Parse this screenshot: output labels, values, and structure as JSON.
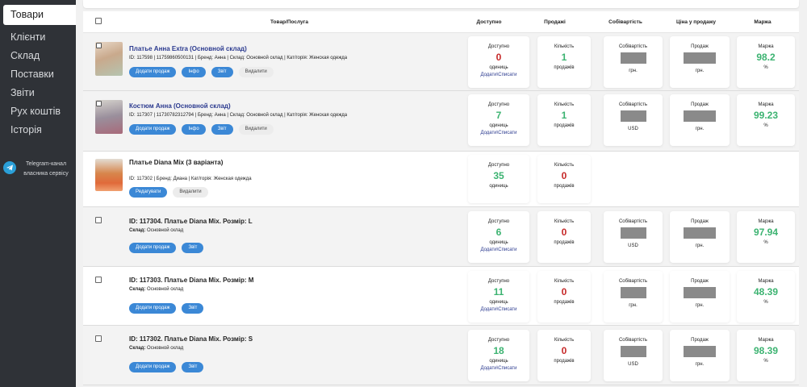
{
  "sidebar": {
    "items": [
      {
        "label": "Товари",
        "active": true
      },
      {
        "label": "Клієнти"
      },
      {
        "label": "Склад"
      },
      {
        "label": "Поставки"
      },
      {
        "label": "Звіти"
      },
      {
        "label": "Рух коштів"
      },
      {
        "label": "Історія"
      }
    ],
    "telegram": "Telegram-канал власника сервісу"
  },
  "table": {
    "headers": {
      "product": "Товар/Послуга",
      "available": "Доступно",
      "sales": "Продажі",
      "cost": "Собівартість",
      "price": "Ціна у продажу",
      "margin": "Маржа"
    }
  },
  "rows": [
    {
      "title": "Платье Анна Extra (Основной склад)",
      "meta": "ID: 117598 | 11759860500131 | Бренд: Анна | Склад: Основной склад | Кат/горія: Женская одежда",
      "buttons": [
        "Додати продаж",
        "Інфо",
        "Звіт",
        "Видалити"
      ],
      "available": {
        "label": "Доступно",
        "value": "0",
        "unit": "одиниць",
        "link": "Додати\\Списати"
      },
      "sales": {
        "label": "Кількість",
        "value": "1",
        "unit": "продажів"
      },
      "cost": {
        "label": "Собівартість",
        "unit": "грн."
      },
      "price": {
        "label": "Продаж",
        "unit": "грн."
      },
      "margin": {
        "label": "Маржа",
        "value": "98.2",
        "unit": "%"
      }
    },
    {
      "title": "Костюм Анна (Основной склад)",
      "meta": "ID: 117307 | 11730782312794 | Бренд: Анна | Склад: Основной склад | Кат/горія: Женская одежда",
      "buttons": [
        "Додати продаж",
        "Інфо",
        "Звіт",
        "Видалити"
      ],
      "available": {
        "label": "Доступно",
        "value": "7",
        "unit": "одиниць",
        "link": "Додати\\Списати"
      },
      "sales": {
        "label": "Кількість",
        "value": "1",
        "unit": "продажів"
      },
      "cost": {
        "label": "Собівартість",
        "unit": "USD"
      },
      "price": {
        "label": "Продаж",
        "unit": "грн."
      },
      "margin": {
        "label": "Маржа",
        "value": "99.23",
        "unit": "%"
      }
    },
    {
      "title": "Платье Diana Mix (3 варіанта)",
      "meta": "ID: 117302 | Бренд: Диана | Кат/горія: Женская одежда",
      "buttons": [
        "Редагувати",
        "Видалити"
      ],
      "available": {
        "label": "Доступно",
        "value": "35",
        "unit": "одиниць"
      },
      "sales": {
        "label": "Кількість",
        "value": "0",
        "unit": "продажів"
      }
    },
    {
      "title": "ID: 117304. Платье Diana Mix. Розмір: L",
      "meta_label": "Склад:",
      "meta_value": "Основной склад",
      "buttons": [
        "Додати продаж",
        "Звіт"
      ],
      "available": {
        "label": "Доступно",
        "value": "6",
        "unit": "одиниць",
        "link": "Додати\\Списати"
      },
      "sales": {
        "label": "Кількість",
        "value": "0",
        "unit": "продажів"
      },
      "cost": {
        "label": "Собівартість",
        "unit": "USD"
      },
      "price": {
        "label": "Продаж",
        "unit": "грн."
      },
      "margin": {
        "label": "Маржа",
        "value": "97.94",
        "unit": "%"
      }
    },
    {
      "title": "ID: 117303. Платье Diana Mix. Розмір: M",
      "meta_label": "Склад:",
      "meta_value": "Основной склад",
      "buttons": [
        "Додати продаж",
        "Звіт"
      ],
      "available": {
        "label": "Доступно",
        "value": "11",
        "unit": "одиниць",
        "link": "Додати\\Списати"
      },
      "sales": {
        "label": "Кількість",
        "value": "0",
        "unit": "продажів"
      },
      "cost": {
        "label": "Собівартість",
        "unit": "грн."
      },
      "price": {
        "label": "Продаж",
        "unit": "грн."
      },
      "margin": {
        "label": "Маржа",
        "value": "48.39",
        "unit": "%"
      }
    },
    {
      "title": "ID: 117302. Платье Diana Mix. Розмір: S",
      "meta_label": "Склад:",
      "meta_value": "Основной склад",
      "buttons": [
        "Додати продаж",
        "Звіт"
      ],
      "available": {
        "label": "Доступно",
        "value": "18",
        "unit": "одиниць",
        "link": "Додати\\Списати"
      },
      "sales": {
        "label": "Кількість",
        "value": "0",
        "unit": "продажів"
      },
      "cost": {
        "label": "Собівартість",
        "unit": "USD"
      },
      "price": {
        "label": "Продаж",
        "unit": "грн."
      },
      "margin": {
        "label": "Маржа",
        "value": "98.39",
        "unit": "%"
      }
    }
  ],
  "colors": {
    "accent": "#3b88d6",
    "sidebar": "#2f3237",
    "red": "#c62828",
    "green": "#3cb371",
    "link": "#2b3a8f"
  }
}
